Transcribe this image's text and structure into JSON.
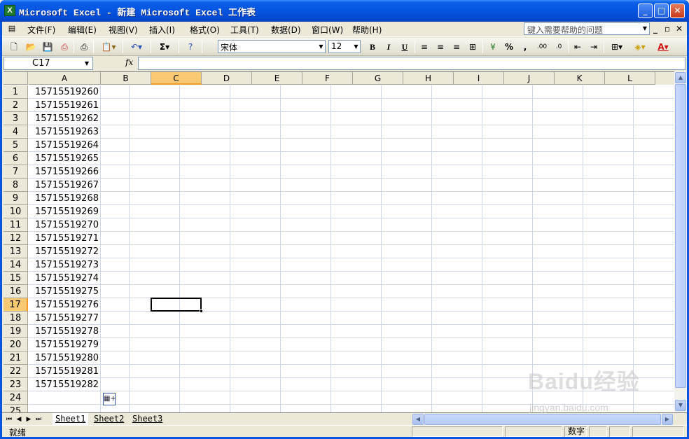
{
  "window": {
    "title": "Microsoft Excel - 新建 Microsoft Excel 工作表",
    "app_icon": "X",
    "minimize": "_",
    "maximize": "□",
    "close": "✕"
  },
  "menu": {
    "items": [
      "文件(F)",
      "编辑(E)",
      "视图(V)",
      "插入(I)",
      "格式(O)",
      "工具(T)",
      "数据(D)",
      "窗口(W)",
      "帮助(H)"
    ],
    "help_placeholder": "键入需要帮助的问题",
    "doc_min": "_",
    "doc_restore": "▫",
    "doc_close": "✕"
  },
  "toolbar": {
    "font": "宋体",
    "size": "12",
    "bold": "B",
    "italic": "I",
    "underline": "U",
    "sum": "Σ",
    "percent": "%",
    "comma": ",",
    "inc_decimal": ".00",
    "dec_decimal": ".0"
  },
  "formula_bar": {
    "name_box": "C17",
    "fx": "fx",
    "content": ""
  },
  "sheet": {
    "columns": [
      "A",
      "B",
      "C",
      "D",
      "E",
      "F",
      "G",
      "H",
      "I",
      "J",
      "K",
      "L"
    ],
    "selected_column": "C",
    "selected_row": "17",
    "rows": [
      "1",
      "2",
      "3",
      "4",
      "5",
      "6",
      "7",
      "8",
      "9",
      "10",
      "11",
      "12",
      "13",
      "14",
      "15",
      "16",
      "17",
      "18",
      "19",
      "20",
      "21",
      "22",
      "23",
      "24",
      "25"
    ],
    "column_a_values": [
      "15715519260",
      "15715519261",
      "15715519262",
      "15715519263",
      "15715519264",
      "15715519265",
      "15715519266",
      "15715519267",
      "15715519268",
      "15715519269",
      "15715519270",
      "15715519271",
      "15715519272",
      "15715519273",
      "15715519274",
      "15715519275",
      "15715519276",
      "15715519277",
      "15715519278",
      "15715519279",
      "15715519280",
      "15715519281",
      "15715519282"
    ],
    "tabs": [
      "Sheet1",
      "Sheet2",
      "Sheet3"
    ],
    "active_tab": "Sheet1"
  },
  "status": {
    "left": "就绪",
    "num": "数字"
  },
  "watermark": {
    "main": "Baidu经验",
    "sub": "jingyan.baidu.com"
  }
}
